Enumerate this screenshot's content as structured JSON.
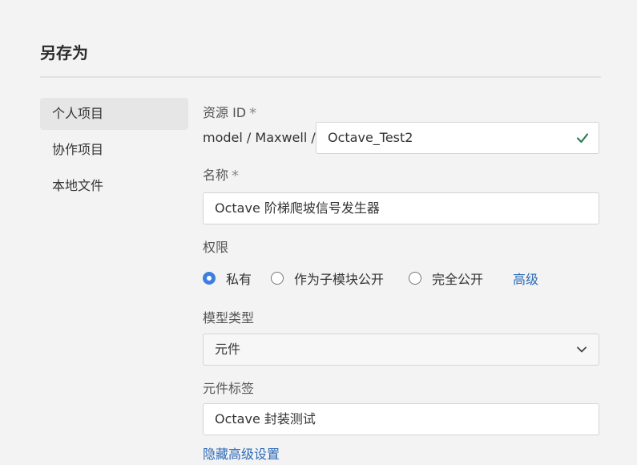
{
  "dialog": {
    "title": "另存为"
  },
  "sidebar": {
    "items": [
      {
        "label": "个人项目",
        "active": true
      },
      {
        "label": "协作项目",
        "active": false
      },
      {
        "label": "本地文件",
        "active": false
      }
    ]
  },
  "form": {
    "resource_id": {
      "label": "资源 ID",
      "required_mark": "*",
      "prefix": "model / Maxwell /",
      "value": "Octave_Test2",
      "valid_icon": "check-icon"
    },
    "name": {
      "label": "名称",
      "required_mark": "*",
      "value": "Octave 阶梯爬坡信号发生器"
    },
    "permission": {
      "label": "权限",
      "options": [
        {
          "label": "私有",
          "selected": true
        },
        {
          "label": "作为子模块公开",
          "selected": false
        },
        {
          "label": "完全公开",
          "selected": false
        }
      ],
      "advanced_link": "高级"
    },
    "model_type": {
      "label": "模型类型",
      "selected": "元件"
    },
    "component_tags": {
      "label": "元件标签",
      "value": "Octave 封装测试"
    },
    "hide_advanced_link": "隐藏高级设置"
  },
  "colors": {
    "accent": "#3d7ee0",
    "link": "#2d6ab8",
    "valid": "#2e7d4f"
  }
}
